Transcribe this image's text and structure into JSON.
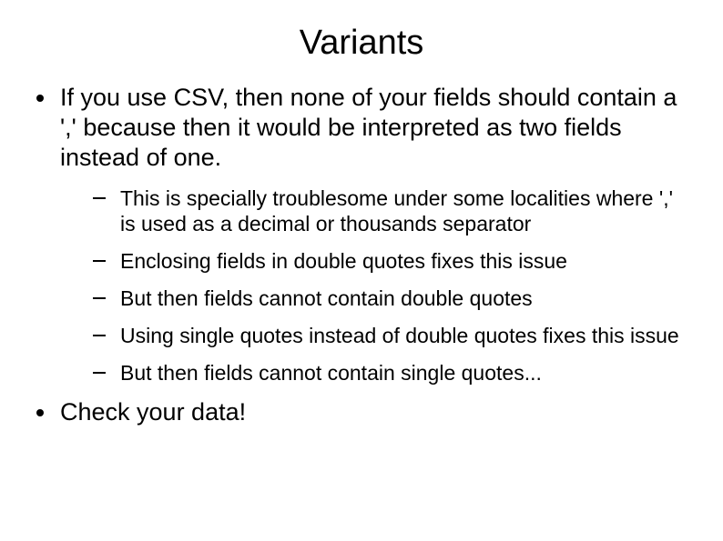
{
  "title": "Variants",
  "bullet1": "If you use CSV, then none of your fields should contain a ',' because then it would be interpreted as two fields instead of one.",
  "sub": {
    "s1": "This is specially troublesome under some localities where ',' is used as a decimal or thousands separator",
    "s2": "Enclosing fields in double quotes fixes this issue",
    "s3": "But then fields cannot contain double quotes",
    "s4": "Using single quotes instead of double quotes fixes this issue",
    "s5": "But then fields cannot contain single quotes..."
  },
  "bullet2": "Check your data!"
}
